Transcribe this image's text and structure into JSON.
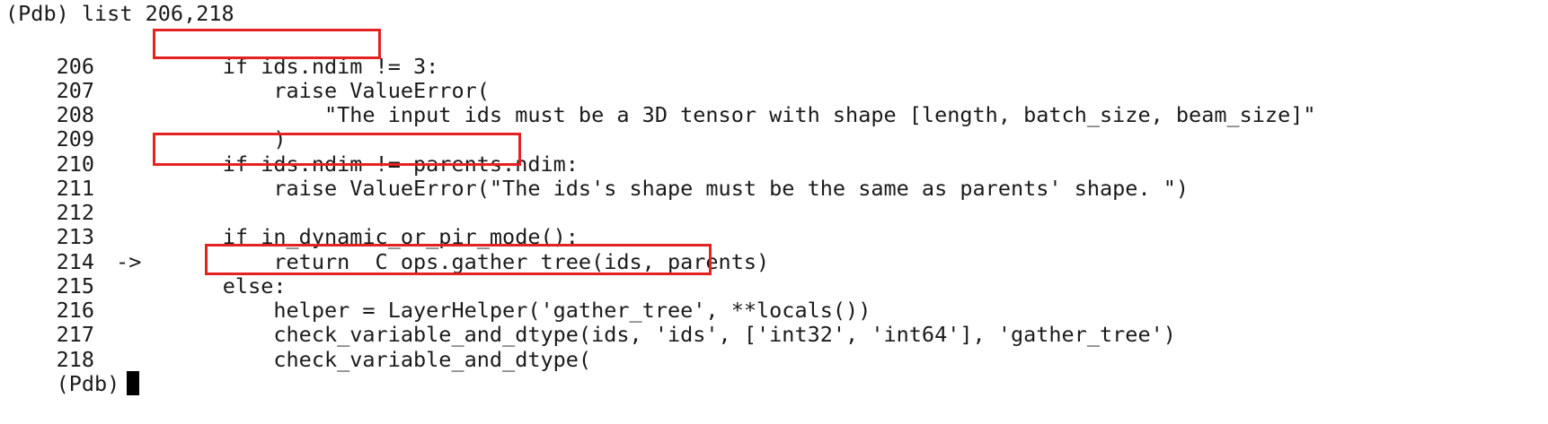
{
  "terminal": {
    "command_line": "(Pdb) list 206,218",
    "lines": [
      {
        "no": "206",
        "arrow": "",
        "code": "        if ids.ndim != 3:"
      },
      {
        "no": "207",
        "arrow": "",
        "code": "            raise ValueError("
      },
      {
        "no": "208",
        "arrow": "",
        "code": "                \"The input ids must be a 3D tensor with shape [length, batch_size, beam_size]\""
      },
      {
        "no": "209",
        "arrow": "",
        "code": "            )"
      },
      {
        "no": "210",
        "arrow": "",
        "code": "        if ids.ndim != parents.ndim:"
      },
      {
        "no": "211",
        "arrow": "",
        "code": "            raise ValueError(\"The ids's shape must be the same as parents' shape. \")"
      },
      {
        "no": "212",
        "arrow": "",
        "code": ""
      },
      {
        "no": "213",
        "arrow": "",
        "code": "        if in_dynamic_or_pir_mode():"
      },
      {
        "no": "214",
        "arrow": "->",
        "code": "            return _C_ops.gather_tree(ids, parents)"
      },
      {
        "no": "215",
        "arrow": "",
        "code": "        else:"
      },
      {
        "no": "216",
        "arrow": "",
        "code": "            helper = LayerHelper('gather_tree', **locals())"
      },
      {
        "no": "217",
        "arrow": "",
        "code": "            check_variable_and_dtype(ids, 'ids', ['int32', 'int64'], 'gather_tree')"
      },
      {
        "no": "218",
        "arrow": "",
        "code": "            check_variable_and_dtype("
      }
    ],
    "prompt": "(Pdb)"
  },
  "colors": {
    "background": "#ffffff",
    "text": "#1a1a1a",
    "highlight_box": "#e52222",
    "cursor": "#000000"
  }
}
